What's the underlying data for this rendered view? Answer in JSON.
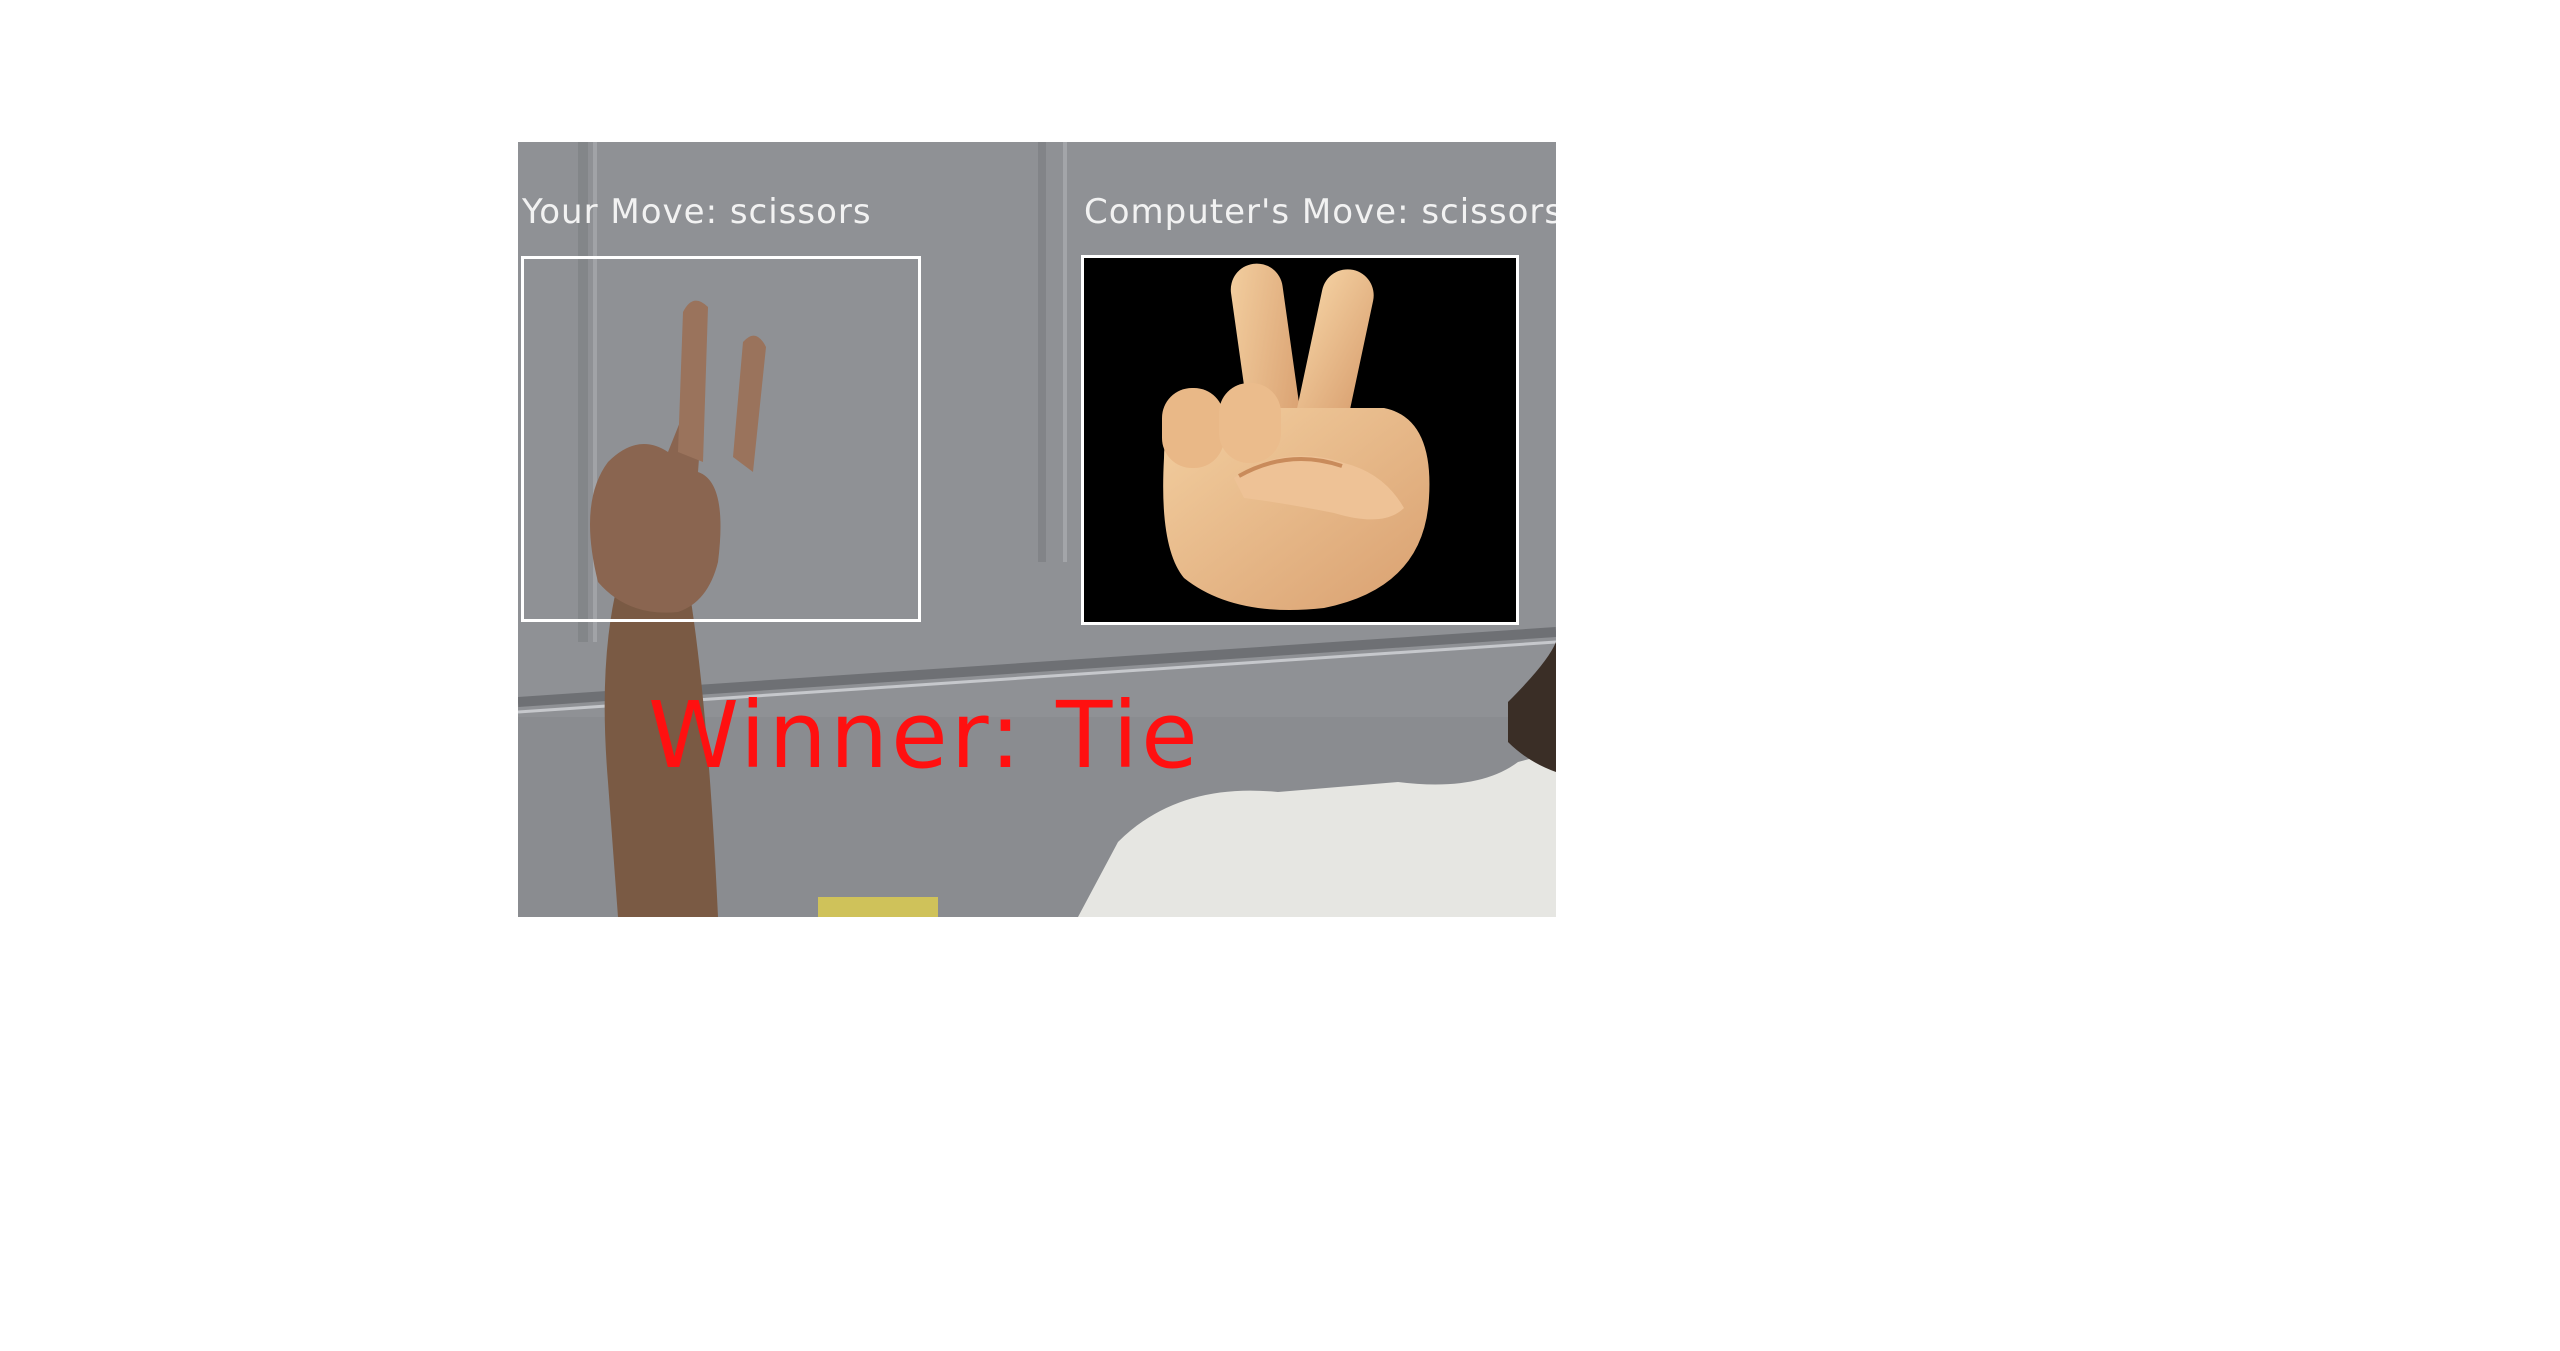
{
  "game": {
    "user_move_label": "Your Move: scissors",
    "computer_move_label": "Computer's Move: scissors",
    "winner_label": "Winner: Tie"
  },
  "colors": {
    "winner_text": "#ff1010",
    "move_text": "#f2f2f2",
    "box_border": "#ffffff"
  },
  "icons": {
    "computer_move": "victory-hand-icon",
    "user_hand": "user-hand-photo"
  }
}
